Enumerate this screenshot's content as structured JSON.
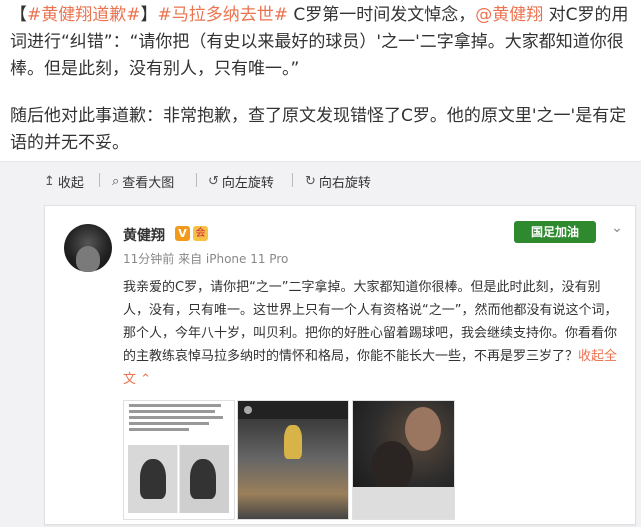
{
  "article": {
    "p1": {
      "open": "【",
      "tag1": "#黄健翔道歉#",
      "close": "】",
      "tag2": "#马拉多纳去世#",
      "t1": " C罗第一时间发文悼念，",
      "mention": "@黄健翔",
      "t2": " 对C罗的用词进行“纠错”：“请你把（有史以来最好的球员）'之一'二字拿掉。大家都知道你很棒。但是此刻，没有别人，只有唯一。”"
    },
    "p2": "随后他对此事道歉：非常抱歉，查了原文发现错怪了C罗。他的原文里'之一'是有定语的并无不妥。"
  },
  "toolbar": {
    "collapse": "收起",
    "view_large": "查看大图",
    "rotate_left": "向左旋转",
    "rotate_right": "向右旋转"
  },
  "post": {
    "username": "黄健翔",
    "verified_badge": "V",
    "member_badge": "会",
    "meta": "11分钟前 来自 iPhone 11 Pro",
    "brand_label": "国足加油",
    "text": "我亲爱的C罗，请你把“之一”二字拿掉。大家都知道你很棒。但是此时此刻，没有别人，没有，只有唯一。这世界上只有一个人有资格说“之一”，然而他都没有说这个词，那个人，今年八十岁，叫贝利。把你的好胜心留着踢球吧，我会继续支持你。你看看你的主教练哀悼马拉多纳时的情怀和格局，你能不能长大一些，不再是罗三岁了？",
    "collapse_link": "收起全文"
  },
  "icons": {
    "collapse": "↥",
    "search": "⌕",
    "rotate_left": "↺",
    "rotate_right": "↻",
    "chevron": "⌄",
    "collapse_caret": "⌃"
  },
  "colors": {
    "link": "#eb7350",
    "toolbar_bg": "#f2f2f5",
    "verified": "#f29a1c"
  }
}
